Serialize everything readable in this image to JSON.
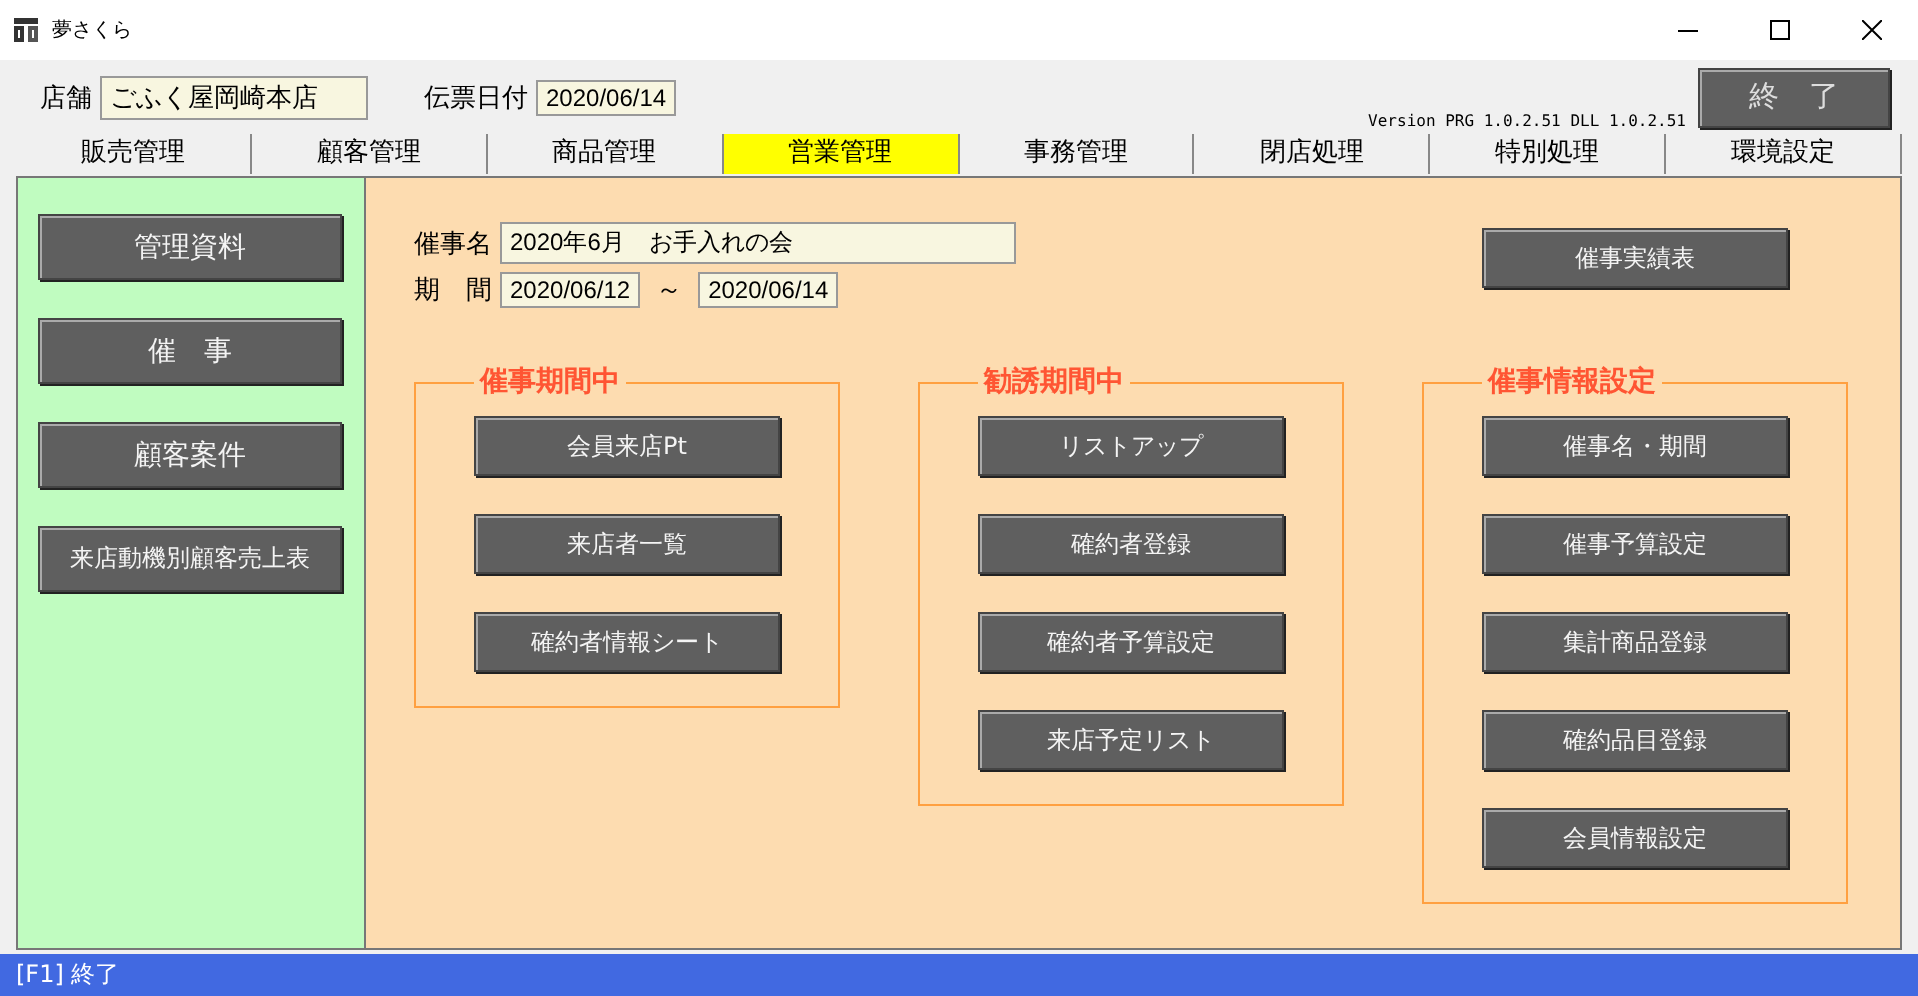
{
  "window": {
    "title": "夢さくら"
  },
  "header": {
    "store_label": "店舗",
    "store": "ごふく屋岡崎本店",
    "date_label": "伝票日付",
    "date": "2020/06/14",
    "version": "Version PRG 1.0.2.51 DLL 1.0.2.51",
    "exit_button": "終　了"
  },
  "tabs": [
    {
      "label": "販売管理",
      "selected": false
    },
    {
      "label": "顧客管理",
      "selected": false
    },
    {
      "label": "商品管理",
      "selected": false
    },
    {
      "label": "営業管理",
      "selected": true
    },
    {
      "label": "事務管理",
      "selected": false
    },
    {
      "label": "閉店処理",
      "selected": false
    },
    {
      "label": "特別処理",
      "selected": false
    },
    {
      "label": "環境設定",
      "selected": false
    }
  ],
  "sidebar": {
    "buttons": [
      "管理資料",
      "催　事",
      "顧客案件",
      "来店動機別顧客売上表"
    ]
  },
  "event": {
    "name_label": "催事名",
    "name": "2020年6月　お手入れの会",
    "period_label": "期　間",
    "start": "2020/06/12",
    "separator": "～",
    "end": "2020/06/14",
    "report_button": "催事実績表"
  },
  "groups": [
    {
      "title": "催事期間中",
      "buttons": [
        "会員来店Pt",
        "来店者一覧",
        "確約者情報シート"
      ]
    },
    {
      "title": "勧誘期間中",
      "buttons": [
        "リストアップ",
        "確約者登録",
        "確約者予算設定",
        "来店予定リスト"
      ]
    },
    {
      "title": "催事情報設定",
      "buttons": [
        "催事名・期間",
        "催事予算設定",
        "集計商品登録",
        "確約品目登録",
        "会員情報設定"
      ]
    }
  ],
  "status_bar": "[F1] 終了"
}
